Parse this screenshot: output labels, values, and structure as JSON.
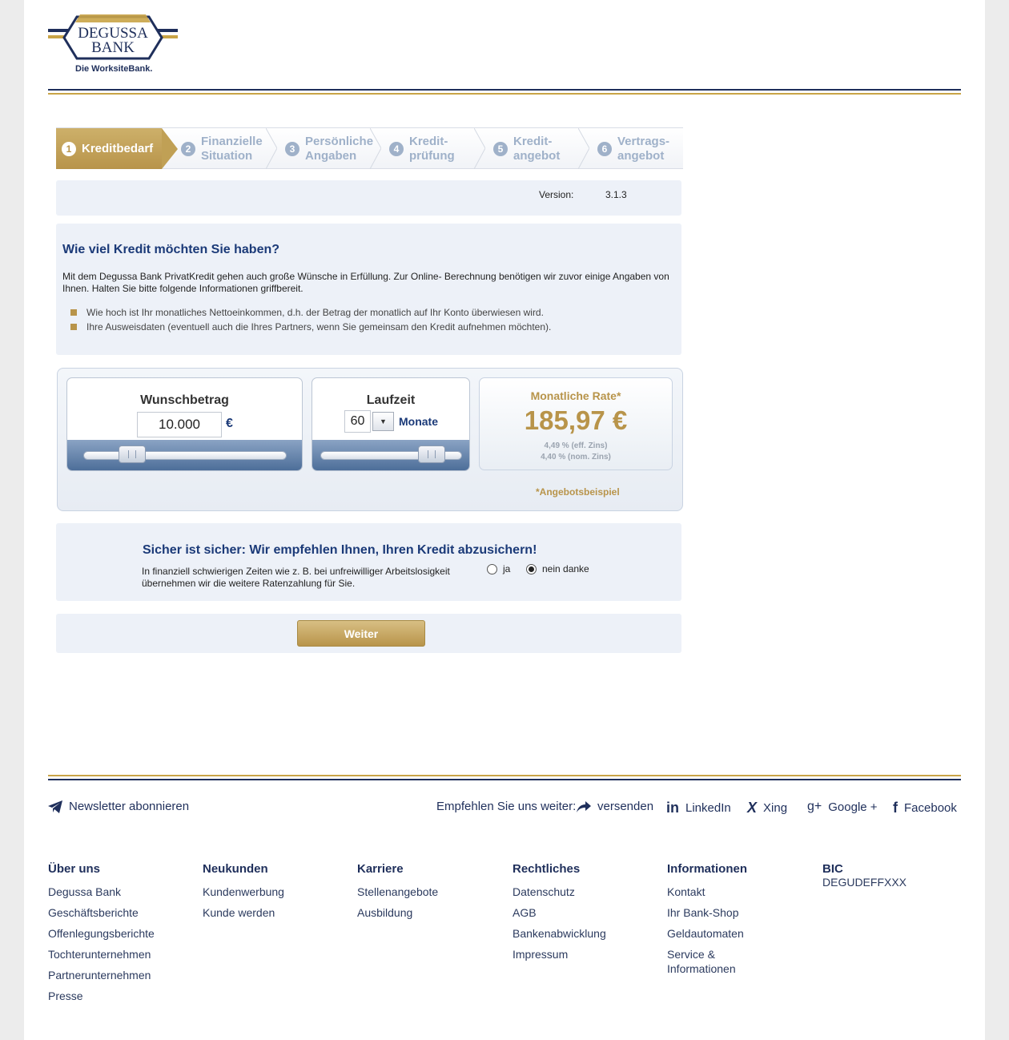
{
  "brand": {
    "line1": "DEGUSSA",
    "line2": "BANK",
    "tagline": "Die WorksiteBank.",
    "colors": {
      "navy": "#1f2f5b",
      "gold": "#c9a447",
      "panel": "#edf1f8"
    }
  },
  "steps": [
    {
      "num": "1",
      "label": "Kreditbedarf",
      "active": true
    },
    {
      "num": "2",
      "label": "Finanzielle\nSituation"
    },
    {
      "num": "3",
      "label": "Persönliche\nAngaben"
    },
    {
      "num": "4",
      "label": "Kredit-\nprüfung"
    },
    {
      "num": "5",
      "label": "Kredit-\nangebot"
    },
    {
      "num": "6",
      "label": "Vertrags-\nangebot"
    }
  ],
  "version": {
    "label": "Version:",
    "value": "3.1.3"
  },
  "intro": {
    "title": "Wie viel Kredit möchten Sie haben?",
    "text": "Mit dem Degussa Bank PrivatKredit gehen auch große Wünsche in Erfüllung. Zur Online- Berechnung benötigen wir zuvor einige Angaben von Ihnen. Halten Sie bitte folgende Informationen griffbereit.",
    "bullets": [
      "Wie hoch ist Ihr monatliches Nettoeinkommen, d.h. der Betrag der monatlich auf Ihr Konto überwiesen wird.",
      "Ihre Ausweisdaten (eventuell auch die Ihres Partners, wenn Sie gemeinsam den Kredit aufnehmen möchten)."
    ]
  },
  "calculator": {
    "amount_title": "Wunschbetrag",
    "amount_value": "10.000",
    "currency": "€",
    "amount_slider_fraction": 0.2,
    "term_title": "Laufzeit",
    "term_value": "60",
    "term_unit": "Monate",
    "term_slider_fraction": 0.85,
    "rate_title": "Monatliche Rate*",
    "rate_value": "185,97 €",
    "eff_rate": "4,49 % (eff. Zins)",
    "nom_rate": "4,40 % (nom. Zins)",
    "footnote": "*Angebotsbeispiel"
  },
  "insurance": {
    "title": "Sicher ist sicher: Wir empfehlen Ihnen, Ihren Kredit abzusichern!",
    "text": "In finanziell schwierigen Zeiten wie z. B. bei unfreiwilliger Arbeitslosigkeit übernehmen wir die weitere Ratenzahlung für Sie.",
    "option_yes": "ja",
    "option_no": "nein danke",
    "selected": "nein danke"
  },
  "actions": {
    "next": "Weiter"
  },
  "footer": {
    "newsletter": "Newsletter abonnieren",
    "recommend": "Empfehlen Sie uns weiter:",
    "send": "versenden",
    "social": {
      "linkedin": "LinkedIn",
      "xing": "Xing",
      "google": "Google +",
      "facebook": "Facebook"
    },
    "columns": [
      {
        "title": "Über uns",
        "links": [
          "Degussa Bank",
          "Geschäftsberichte",
          "Offenlegungsberichte",
          "Tochterunternehmen",
          "Partnerunternehmen",
          "Presse"
        ]
      },
      {
        "title": "Neukunden",
        "links": [
          "Kundenwerbung",
          "Kunde werden"
        ]
      },
      {
        "title": "Karriere",
        "links": [
          "Stellenangebote",
          "Ausbildung"
        ]
      },
      {
        "title": "Rechtliches",
        "links": [
          "Datenschutz",
          "AGB",
          "Bankenabwicklung",
          "Impressum"
        ]
      },
      {
        "title": "Informationen",
        "links": [
          "Kontakt",
          "Ihr Bank-Shop",
          "Geldautomaten",
          "Service & Informationen"
        ]
      }
    ],
    "bic_label": "BIC",
    "bic_value": "DEGUDEFFXXX"
  }
}
